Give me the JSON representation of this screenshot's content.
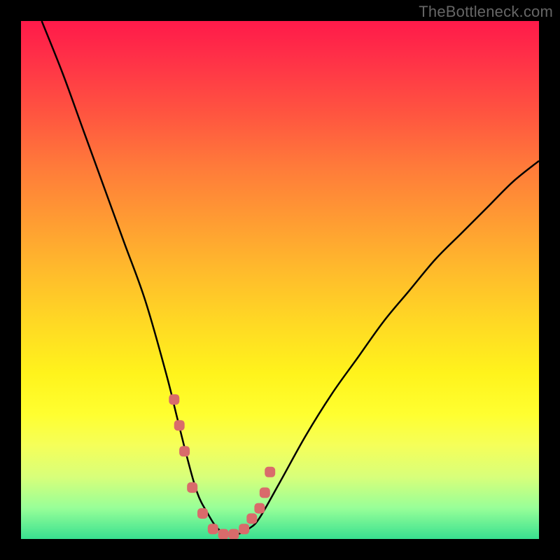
{
  "watermark": "TheBottleneck.com",
  "colors": {
    "background": "#000000",
    "curve_stroke": "#000000",
    "marker_fill": "#d96b6b",
    "gradient_top": "#ff1a4a",
    "gradient_bottom": "#38e090"
  },
  "chart_data": {
    "type": "line",
    "title": "",
    "xlabel": "",
    "ylabel": "",
    "xlim": [
      0,
      100
    ],
    "ylim": [
      0,
      100
    ],
    "grid": false,
    "legend": false,
    "note": "No axes or numeric tick labels are rendered; values are estimated from geometry. y = bottleneck percentage (0 = none, 100 = severe).",
    "series": [
      {
        "name": "bottleneck-curve",
        "x": [
          4,
          8,
          12,
          16,
          20,
          24,
          28,
          30,
          32,
          34,
          36,
          38,
          40,
          42,
          44,
          46,
          50,
          55,
          60,
          65,
          70,
          75,
          80,
          85,
          90,
          95,
          100
        ],
        "y": [
          100,
          90,
          79,
          68,
          57,
          46,
          32,
          24,
          16,
          9,
          5,
          2,
          1,
          1,
          2,
          4,
          11,
          20,
          28,
          35,
          42,
          48,
          54,
          59,
          64,
          69,
          73
        ]
      }
    ],
    "markers": {
      "name": "valley-markers",
      "x": [
        29.5,
        30.5,
        31.5,
        33,
        35,
        37,
        39,
        41,
        43,
        44.5,
        46,
        47,
        48
      ],
      "y": [
        27,
        22,
        17,
        10,
        5,
        2,
        1,
        1,
        2,
        4,
        6,
        9,
        13
      ]
    }
  }
}
